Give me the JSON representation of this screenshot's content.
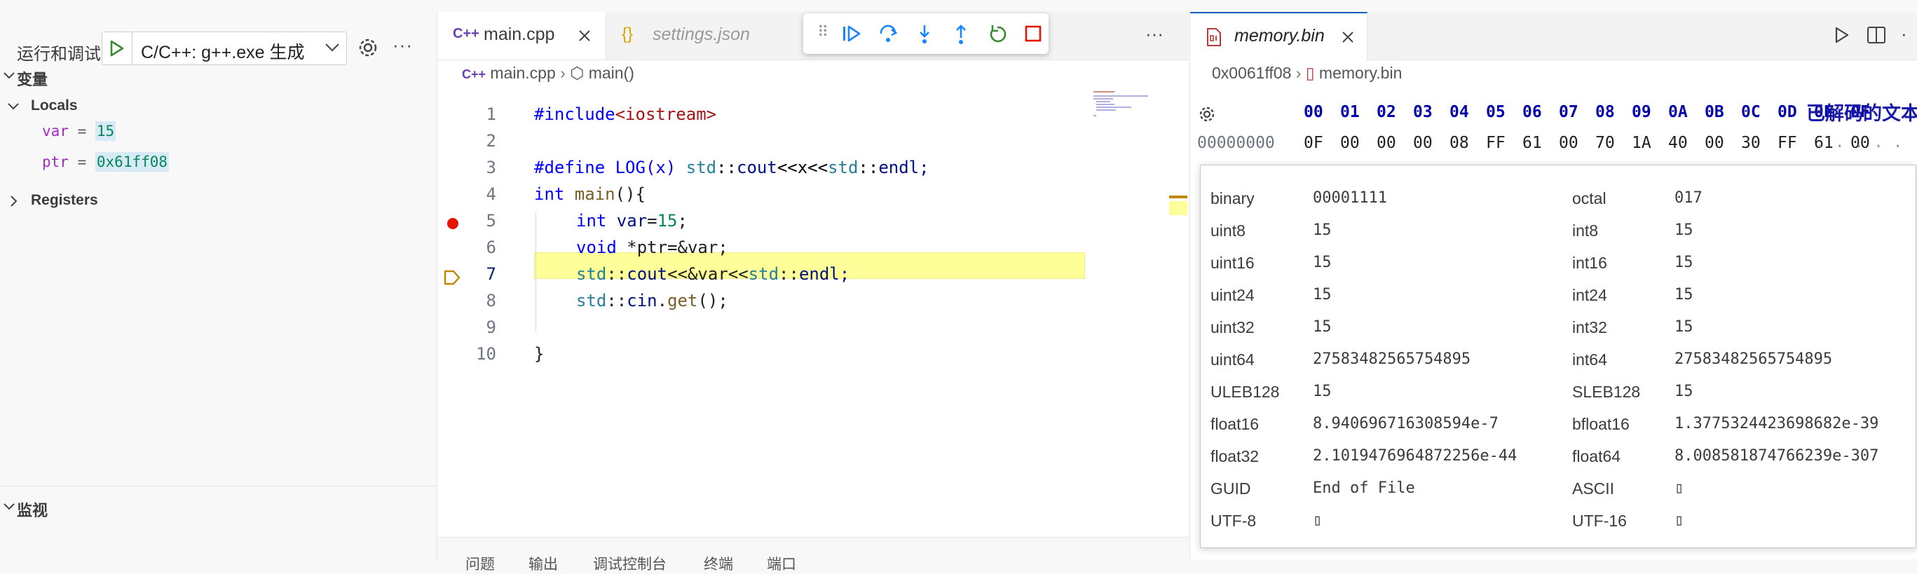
{
  "debug_panel": {
    "title": "运行和调试",
    "config_label": "C/C++: g++.exe 生成",
    "variables_header": "变量",
    "locals_header": "Locals",
    "locals": [
      {
        "name": "var",
        "value": "15"
      },
      {
        "name": "ptr",
        "value": "0x61ff08"
      }
    ],
    "registers_header": "Registers",
    "watch_header": "监视"
  },
  "editor": {
    "tabs": [
      {
        "label": "main.cpp",
        "icon": "C++"
      },
      {
        "label": "settings.json",
        "icon": "{}"
      }
    ],
    "breadcrumb": {
      "file": "main.cpp",
      "symbol": "main()"
    },
    "line_numbers": [
      "1",
      "2",
      "3",
      "4",
      "5",
      "6",
      "7",
      "8",
      "9",
      "10"
    ],
    "breakpoint_line": 5,
    "current_line": 7,
    "code": {
      "l1_pp": "#include",
      "l1_inc": "<iostream>",
      "l3_pp": "#define",
      "l3_macro": " LOG(x) ",
      "l3_ns1": "std",
      "l3_op1": "::",
      "l3_id1": "cout",
      "l3_op2": "<<x<<",
      "l3_ns2": "std",
      "l3_op3": "::",
      "l3_id2": "endl;",
      "l4_kw": "int",
      "l4_fn": " main",
      "l4_rest": "(){",
      "l5_kw": "int",
      "l5_id": " var",
      "l5_op": "=",
      "l5_num": "15",
      "l5_end": ";",
      "l6_kw": "void",
      "l6_rest": " *ptr=&var;",
      "l7_ns": "std",
      "l7_op": "::",
      "l7_id": "cout",
      "l7_op2": "<<",
      "l7_mid": "&var",
      "l7_op3": "<<",
      "l7_ns2": "std",
      "l7_op4": "::",
      "l7_end": "endl;",
      "l8_ns": "std",
      "l8_op": "::",
      "l8_id": "cin",
      "l8_dot": ".",
      "l8_fn": "get",
      "l8_end": "();",
      "l10": "}"
    },
    "panel_tabs": [
      "问题",
      "输出",
      "调试控制台",
      "终端",
      "端口"
    ]
  },
  "hex_editor": {
    "tab_label": "memory.bin",
    "breadcrumb": {
      "address": "0x0061ff08",
      "file": "memory.bin"
    },
    "columns": [
      "00",
      "01",
      "02",
      "03",
      "04",
      "05",
      "06",
      "07",
      "08",
      "09",
      "0A",
      "0B",
      "0C",
      "0D",
      "0E",
      "0F"
    ],
    "decoded_title": "已解码的文本",
    "row0": {
      "offset": "00000000",
      "bytes": [
        "0F",
        "00",
        "00",
        "00",
        "08",
        "FF",
        "61",
        "00",
        "70",
        "1A",
        "40",
        "00",
        "30",
        "FF",
        "61",
        "00"
      ],
      "decoded": ". . . . . ."
    },
    "inspector": [
      {
        "k1": "binary",
        "v1": "00001111",
        "k2": "octal",
        "v2": "017"
      },
      {
        "k1": "uint8",
        "v1": "15",
        "k2": "int8",
        "v2": "15"
      },
      {
        "k1": "uint16",
        "v1": "15",
        "k2": "int16",
        "v2": "15"
      },
      {
        "k1": "uint24",
        "v1": "15",
        "k2": "int24",
        "v2": "15"
      },
      {
        "k1": "uint32",
        "v1": "15",
        "k2": "int32",
        "v2": "15"
      },
      {
        "k1": "uint64",
        "v1": "27583482565754895",
        "k2": "int64",
        "v2": "27583482565754895"
      },
      {
        "k1": "ULEB128",
        "v1": "15",
        "k2": "SLEB128",
        "v2": "15"
      },
      {
        "k1": "float16",
        "v1": "8.940696716308594e-7",
        "k2": "bfloat16",
        "v2": "1.3775324423698682e-39"
      },
      {
        "k1": "float32",
        "v1": "2.1019476964872256e-44",
        "k2": "float64",
        "v2": "8.008581874766239e-307"
      },
      {
        "k1": "GUID",
        "v1": "End of File",
        "k2": "ASCII",
        "v2": "\u0000"
      },
      {
        "k1": "UTF-8",
        "v1": "\u0000",
        "k2": "UTF-16",
        "v2": "\u0000"
      }
    ]
  },
  "colors": {
    "accent": "#005fb8",
    "breakpoint": "#e51400",
    "current_line_bg": "#ffff99",
    "current_line_arrow": "#be8700",
    "var_name": "#a42ac4",
    "var_value": "#098658"
  }
}
